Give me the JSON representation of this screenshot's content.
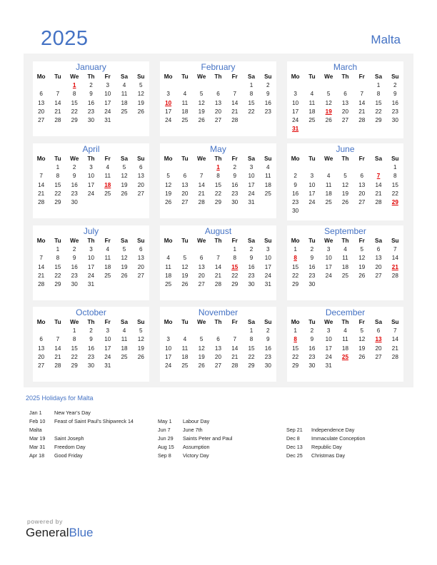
{
  "header": {
    "year": "2025",
    "country": "Malta"
  },
  "colors": {
    "accent": "#4472c4",
    "holiday": "#e00000",
    "panel_bg": "#f2f2f2"
  },
  "weekday_labels": [
    "Mo",
    "Tu",
    "We",
    "Th",
    "Fr",
    "Sa",
    "Su"
  ],
  "months": [
    {
      "name": "January",
      "weeks": [
        [
          "",
          "",
          "1",
          "2",
          "3",
          "4",
          "5"
        ],
        [
          "6",
          "7",
          "8",
          "9",
          "10",
          "11",
          "12"
        ],
        [
          "13",
          "14",
          "15",
          "16",
          "17",
          "18",
          "19"
        ],
        [
          "20",
          "21",
          "22",
          "23",
          "24",
          "25",
          "26"
        ],
        [
          "27",
          "28",
          "29",
          "30",
          "31",
          "",
          ""
        ]
      ],
      "holidays": [
        "1"
      ]
    },
    {
      "name": "February",
      "weeks": [
        [
          "",
          "",
          "",
          "",
          "",
          "1",
          "2"
        ],
        [
          "3",
          "4",
          "5",
          "6",
          "7",
          "8",
          "9"
        ],
        [
          "10",
          "11",
          "12",
          "13",
          "14",
          "15",
          "16"
        ],
        [
          "17",
          "18",
          "19",
          "20",
          "21",
          "22",
          "23"
        ],
        [
          "24",
          "25",
          "26",
          "27",
          "28",
          "",
          ""
        ]
      ],
      "holidays": [
        "10"
      ]
    },
    {
      "name": "March",
      "weeks": [
        [
          "",
          "",
          "",
          "",
          "",
          "1",
          "2"
        ],
        [
          "3",
          "4",
          "5",
          "6",
          "7",
          "8",
          "9"
        ],
        [
          "10",
          "11",
          "12",
          "13",
          "14",
          "15",
          "16"
        ],
        [
          "17",
          "18",
          "19",
          "20",
          "21",
          "22",
          "23"
        ],
        [
          "24",
          "25",
          "26",
          "27",
          "28",
          "29",
          "30"
        ],
        [
          "31",
          "",
          "",
          "",
          "",
          "",
          ""
        ]
      ],
      "holidays": [
        "19",
        "31"
      ]
    },
    {
      "name": "April",
      "weeks": [
        [
          "",
          "1",
          "2",
          "3",
          "4",
          "5",
          "6"
        ],
        [
          "7",
          "8",
          "9",
          "10",
          "11",
          "12",
          "13"
        ],
        [
          "14",
          "15",
          "16",
          "17",
          "18",
          "19",
          "20"
        ],
        [
          "21",
          "22",
          "23",
          "24",
          "25",
          "26",
          "27"
        ],
        [
          "28",
          "29",
          "30",
          "",
          "",
          "",
          ""
        ]
      ],
      "holidays": [
        "18"
      ]
    },
    {
      "name": "May",
      "weeks": [
        [
          "",
          "",
          "",
          "1",
          "2",
          "3",
          "4"
        ],
        [
          "5",
          "6",
          "7",
          "8",
          "9",
          "10",
          "11"
        ],
        [
          "12",
          "13",
          "14",
          "15",
          "16",
          "17",
          "18"
        ],
        [
          "19",
          "20",
          "21",
          "22",
          "23",
          "24",
          "25"
        ],
        [
          "26",
          "27",
          "28",
          "29",
          "30",
          "31",
          ""
        ]
      ],
      "holidays": [
        "1"
      ]
    },
    {
      "name": "June",
      "weeks": [
        [
          "",
          "",
          "",
          "",
          "",
          "",
          "1"
        ],
        [
          "2",
          "3",
          "4",
          "5",
          "6",
          "7",
          "8"
        ],
        [
          "9",
          "10",
          "11",
          "12",
          "13",
          "14",
          "15"
        ],
        [
          "16",
          "17",
          "18",
          "19",
          "20",
          "21",
          "22"
        ],
        [
          "23",
          "24",
          "25",
          "26",
          "27",
          "28",
          "29"
        ],
        [
          "30",
          "",
          "",
          "",
          "",
          "",
          ""
        ]
      ],
      "holidays": [
        "7",
        "29"
      ]
    },
    {
      "name": "July",
      "weeks": [
        [
          "",
          "1",
          "2",
          "3",
          "4",
          "5",
          "6"
        ],
        [
          "7",
          "8",
          "9",
          "10",
          "11",
          "12",
          "13"
        ],
        [
          "14",
          "15",
          "16",
          "17",
          "18",
          "19",
          "20"
        ],
        [
          "21",
          "22",
          "23",
          "24",
          "25",
          "26",
          "27"
        ],
        [
          "28",
          "29",
          "30",
          "31",
          "",
          "",
          ""
        ]
      ],
      "holidays": []
    },
    {
      "name": "August",
      "weeks": [
        [
          "",
          "",
          "",
          "",
          "1",
          "2",
          "3"
        ],
        [
          "4",
          "5",
          "6",
          "7",
          "8",
          "9",
          "10"
        ],
        [
          "11",
          "12",
          "13",
          "14",
          "15",
          "16",
          "17"
        ],
        [
          "18",
          "19",
          "20",
          "21",
          "22",
          "23",
          "24"
        ],
        [
          "25",
          "26",
          "27",
          "28",
          "29",
          "30",
          "31"
        ]
      ],
      "holidays": [
        "15"
      ]
    },
    {
      "name": "September",
      "weeks": [
        [
          "1",
          "2",
          "3",
          "4",
          "5",
          "6",
          "7"
        ],
        [
          "8",
          "9",
          "10",
          "11",
          "12",
          "13",
          "14"
        ],
        [
          "15",
          "16",
          "17",
          "18",
          "19",
          "20",
          "21"
        ],
        [
          "22",
          "23",
          "24",
          "25",
          "26",
          "27",
          "28"
        ],
        [
          "29",
          "30",
          "",
          "",
          "",
          "",
          ""
        ]
      ],
      "holidays": [
        "8",
        "21"
      ]
    },
    {
      "name": "October",
      "weeks": [
        [
          "",
          "",
          "1",
          "2",
          "3",
          "4",
          "5"
        ],
        [
          "6",
          "7",
          "8",
          "9",
          "10",
          "11",
          "12"
        ],
        [
          "13",
          "14",
          "15",
          "16",
          "17",
          "18",
          "19"
        ],
        [
          "20",
          "21",
          "22",
          "23",
          "24",
          "25",
          "26"
        ],
        [
          "27",
          "28",
          "29",
          "30",
          "31",
          "",
          ""
        ]
      ],
      "holidays": []
    },
    {
      "name": "November",
      "weeks": [
        [
          "",
          "",
          "",
          "",
          "",
          "1",
          "2"
        ],
        [
          "3",
          "4",
          "5",
          "6",
          "7",
          "8",
          "9"
        ],
        [
          "10",
          "11",
          "12",
          "13",
          "14",
          "15",
          "16"
        ],
        [
          "17",
          "18",
          "19",
          "20",
          "21",
          "22",
          "23"
        ],
        [
          "24",
          "25",
          "26",
          "27",
          "28",
          "29",
          "30"
        ]
      ],
      "holidays": []
    },
    {
      "name": "December",
      "weeks": [
        [
          "1",
          "2",
          "3",
          "4",
          "5",
          "6",
          "7"
        ],
        [
          "8",
          "9",
          "10",
          "11",
          "12",
          "13",
          "14"
        ],
        [
          "15",
          "16",
          "17",
          "18",
          "19",
          "20",
          "21"
        ],
        [
          "22",
          "23",
          "24",
          "25",
          "26",
          "27",
          "28"
        ],
        [
          "29",
          "30",
          "31",
          "",
          "",
          "",
          ""
        ]
      ],
      "holidays": [
        "8",
        "13",
        "25"
      ]
    }
  ],
  "holidays_section": {
    "title": "2025 Holidays for Malta",
    "columns": [
      [
        {
          "date": "Jan 1",
          "name": "New Year’s Day"
        },
        {
          "date": "Feb 10",
          "name": "Feast of Saint Paul’s Shipwreck 14"
        },
        {
          "date": "Malta",
          "name": ""
        },
        {
          "date": "Mar 19",
          "name": "Saint Joseph"
        },
        {
          "date": "Mar 31",
          "name": "Freedom Day"
        },
        {
          "date": "Apr 18",
          "name": "Good Friday"
        }
      ],
      [
        {
          "date": "May 1",
          "name": "Labour Day"
        },
        {
          "date": "Jun 7",
          "name": "June 7th"
        },
        {
          "date": "Jun 29",
          "name": "Saints Peter and Paul"
        },
        {
          "date": "Aug 15",
          "name": "Assumption"
        },
        {
          "date": "Sep 8",
          "name": "Victory Day"
        }
      ],
      [
        {
          "date": "Sep 21",
          "name": "Independence Day"
        },
        {
          "date": "Dec 8",
          "name": "Immaculate Conception"
        },
        {
          "date": "Dec 13",
          "name": "Republic Day"
        },
        {
          "date": "Dec 25",
          "name": "Christmas Day"
        }
      ]
    ]
  },
  "footer": {
    "powered_by": "powered by",
    "brand_part1": "General",
    "brand_part2": "Blue"
  }
}
